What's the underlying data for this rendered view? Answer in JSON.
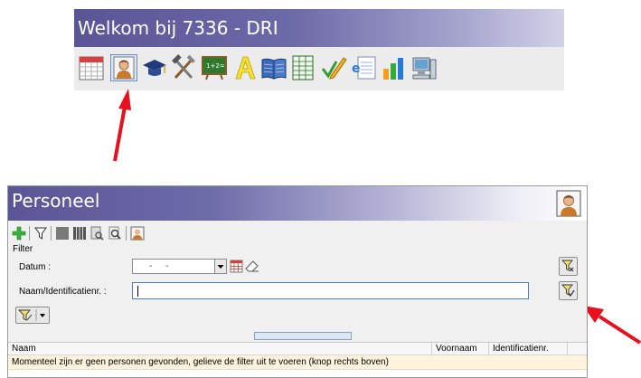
{
  "top_window": {
    "title": "Welkom bij 7336 - DRI",
    "toolbar_icons": [
      "calendar-icon",
      "personnel-icon",
      "graduation-cap-icon",
      "tools-icon",
      "chalkboard-icon",
      "letter-a-icon",
      "open-book-icon",
      "spreadsheet-icon",
      "pencil-check-icon",
      "e-document-icon",
      "bar-chart-icon",
      "computer-icon"
    ]
  },
  "personeel": {
    "title": "Personeel",
    "toolbar_icons": [
      "add-icon",
      "filter-icon",
      "gray-block-icon",
      "columns-icon",
      "print-preview-icon",
      "search-document-icon",
      "personnel-icon"
    ],
    "filter": {
      "legend": "Filter",
      "datum_label": "Datum :",
      "datum_value": "- -",
      "naam_label": "Naam/Identificatienr. :",
      "naam_value": ""
    },
    "grid": {
      "columns": [
        "Naam",
        "Voornaam",
        "Identificatienr."
      ],
      "empty_message": "Momenteel zijn er geen personen gevonden, gelieve de filter uit te voeren (knop rechts boven)"
    }
  },
  "colors": {
    "title_bar_start": "#5a5596",
    "arrow": "#e8101c",
    "row_highlight": "#fdf3dd"
  }
}
